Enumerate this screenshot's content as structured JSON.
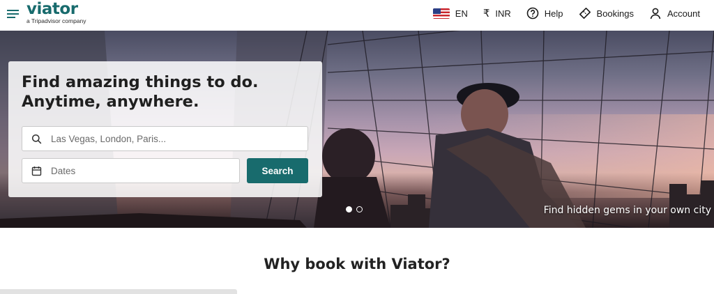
{
  "header": {
    "logo_text": "viator",
    "logo_subtext": "a Tripadvisor company",
    "nav": {
      "language": "EN",
      "currency": "INR",
      "help": "Help",
      "bookings": "Bookings",
      "account": "Account"
    }
  },
  "hero": {
    "headline_line1": "Find amazing things to do.",
    "headline_line2": "Anytime, anywhere.",
    "search": {
      "destination_placeholder": "Las Vegas, London, Paris...",
      "dates_placeholder": "Dates",
      "button_label": "Search"
    },
    "carousel": {
      "slide_count": 2,
      "active_index": 0
    },
    "caption": "Find hidden gems in your own city"
  },
  "sections": {
    "why_title": "Why book with Viator?"
  },
  "colors": {
    "brand": "#186b6d",
    "text": "#1a1a1a"
  },
  "icons": [
    "menu-icon",
    "us-flag-icon",
    "rupee-icon",
    "help-icon",
    "bookings-icon",
    "account-icon",
    "search-icon",
    "calendar-icon"
  ]
}
